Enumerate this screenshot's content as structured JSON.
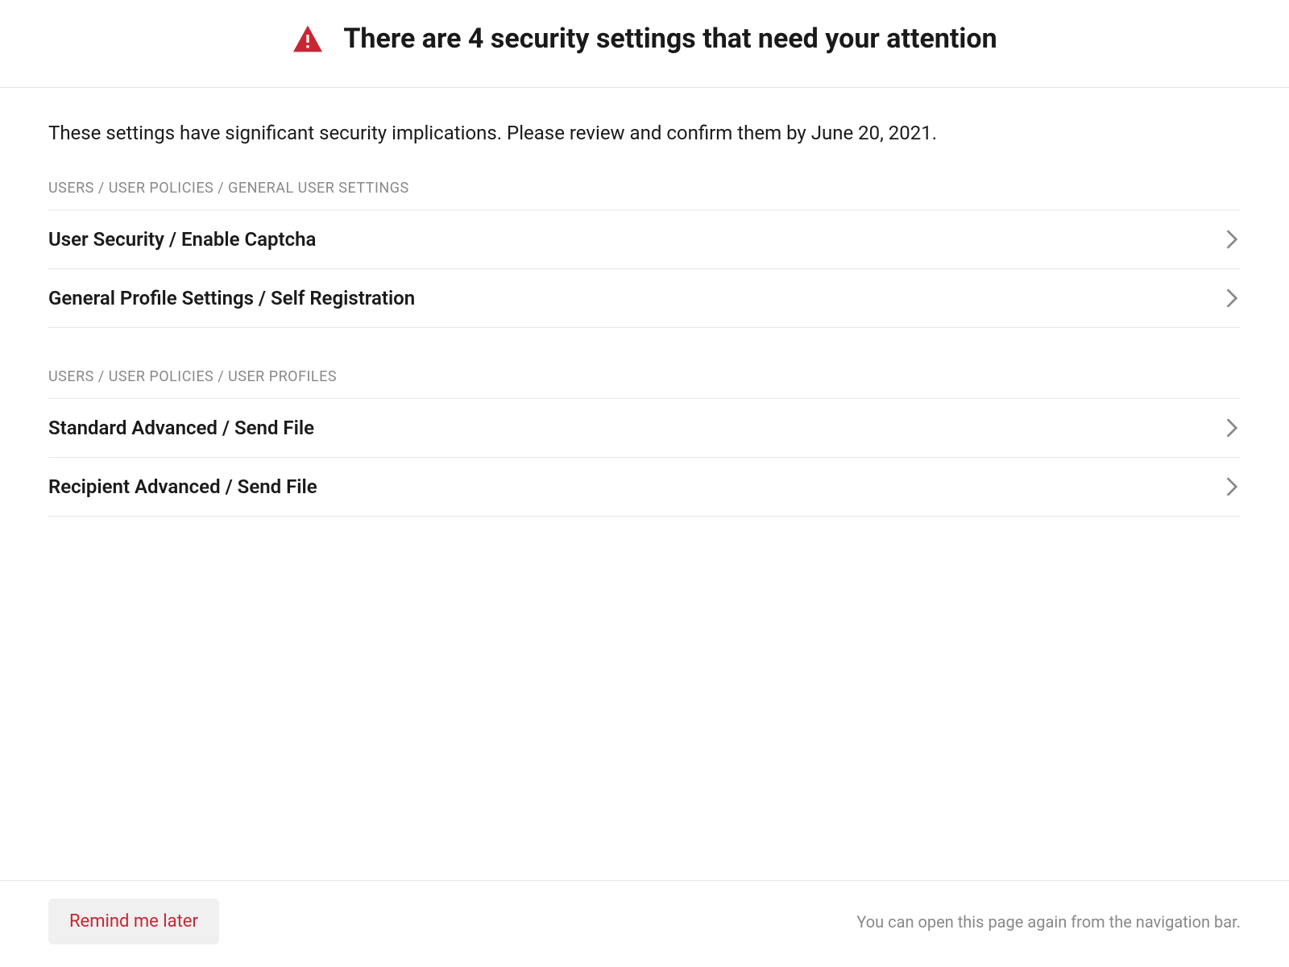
{
  "header": {
    "title": "There are 4 security settings that need your attention"
  },
  "intro": "These settings have significant security implications. Please review and confirm them by June 20, 2021.",
  "sections": [
    {
      "breadcrumb": "USERS / USER POLICIES / GENERAL USER SETTINGS",
      "items": [
        {
          "label": "User Security / Enable Captcha"
        },
        {
          "label": "General Profile Settings / Self Registration"
        }
      ]
    },
    {
      "breadcrumb": "USERS / USER POLICIES / USER PROFILES",
      "items": [
        {
          "label": "Standard Advanced / Send File"
        },
        {
          "label": "Recipient Advanced / Send File"
        }
      ]
    }
  ],
  "footer": {
    "remind_label": "Remind me later",
    "info_text": "You can open this page again from the navigation bar."
  },
  "colors": {
    "warning": "#c62733",
    "chevron": "#888888"
  }
}
